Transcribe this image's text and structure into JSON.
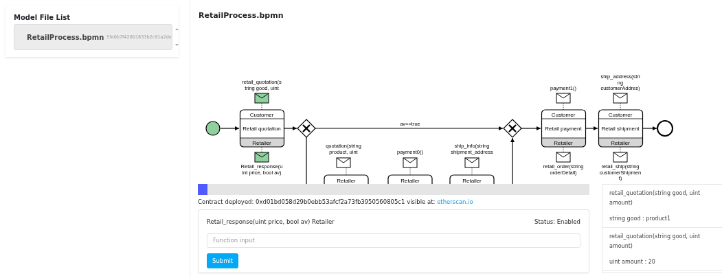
{
  "sidebar": {
    "title": "Model File List",
    "files": [
      {
        "name": "RetailProcess.bpmn",
        "hash": "5fe0b7f42801833b2c91a2de",
        "selected": true
      }
    ]
  },
  "diagram": {
    "title": "RetailProcess.bpmn",
    "start": {
      "completed": true
    },
    "flow_label": "av==true",
    "tasks": [
      {
        "top": "Customer",
        "name": "Retail quotation",
        "bottom": "Retailer"
      },
      {
        "top": "Customer",
        "name": "Retail payment",
        "bottom": "Retailer"
      },
      {
        "top": "Customer",
        "name": "Retail shipment",
        "bottom": "Retailer"
      }
    ],
    "lower_tasks": [
      {
        "label": "Retailer"
      },
      {
        "label": "Retailer"
      },
      {
        "label": "Retailer"
      }
    ],
    "messages": [
      {
        "lines": [
          "retail_quotation(s",
          "tring good, uint"
        ],
        "completed": true
      },
      {
        "lines": [
          "Retail_response(u",
          "int price, bool av)"
        ],
        "completed": true
      },
      {
        "lines": [
          "quotation(string",
          "product, uint"
        ],
        "completed": false
      },
      {
        "lines": [
          "payment0()"
        ],
        "completed": false
      },
      {
        "lines": [
          "ship_info(string",
          "shipment_address"
        ],
        "completed": false
      },
      {
        "lines": [
          "payment1()"
        ],
        "completed": false
      },
      {
        "lines": [
          "retail_order(string",
          "orderDetail)"
        ],
        "completed": false
      },
      {
        "lines": [
          "ship_address(stri",
          "ng",
          "customerAddres)"
        ],
        "completed": false
      },
      {
        "lines": [
          "retail_ship(string",
          "customerShipmen",
          "t)"
        ],
        "completed": false
      }
    ]
  },
  "progress": {
    "level": 0.025
  },
  "contract": {
    "text": "Contract deployed: 0xd01bd058d29b0ebb53afcf2a73fb3950560805c1 visible at:",
    "link": "etherscan.io"
  },
  "function_card": {
    "signature": "Retail_response(uint price, bool av) Retailer",
    "status": "Status: Enabled",
    "placeholder": "Function input",
    "button": "Submit"
  },
  "inputs": [
    {
      "title": "retail_quotation(string good, uint amount)",
      "value": "string good : product1"
    },
    {
      "title": "retail_quotation(string good, uint amount)",
      "value": "uint amount : 20"
    }
  ]
}
